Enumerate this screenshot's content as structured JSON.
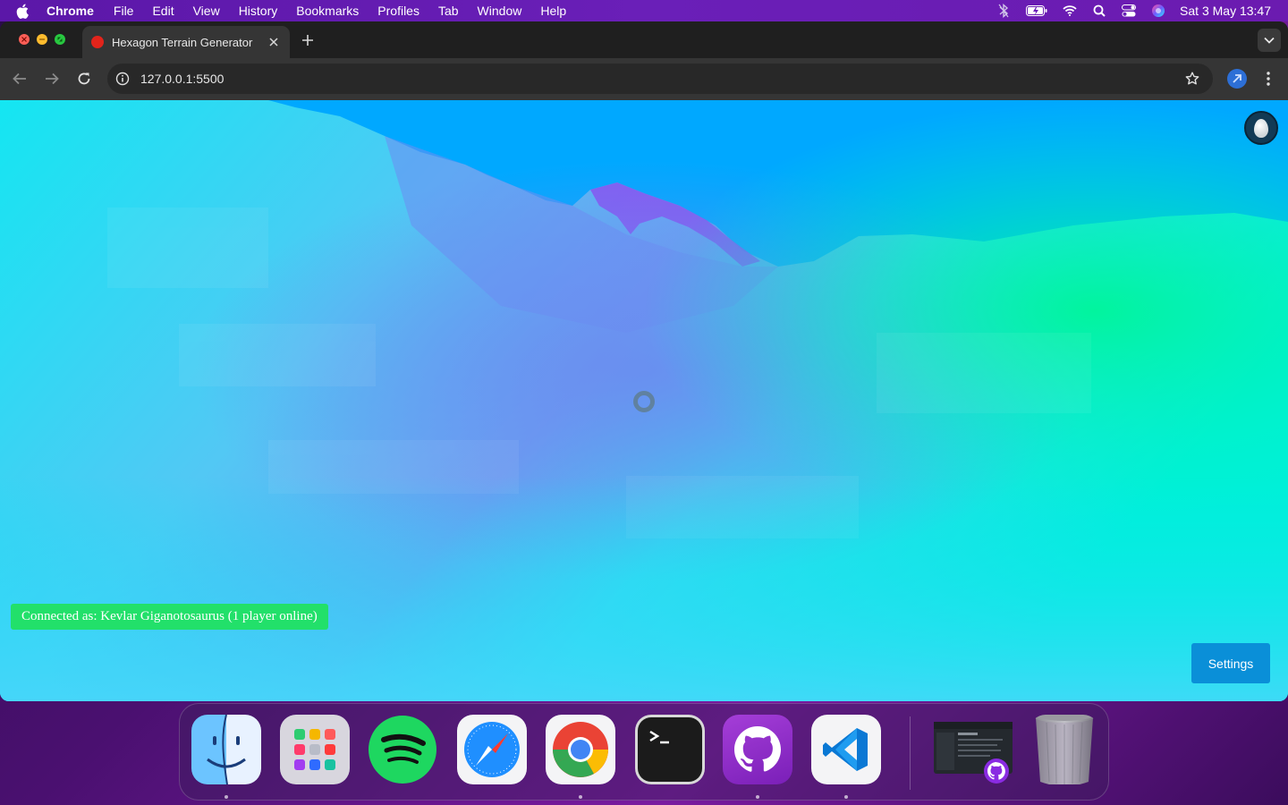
{
  "menubar": {
    "apple_icon": "apple-logo-icon",
    "app_name": "Chrome",
    "items": [
      "File",
      "Edit",
      "View",
      "History",
      "Bookmarks",
      "Profiles",
      "Tab",
      "Window",
      "Help"
    ],
    "status_icons": [
      "bluetooth-icon",
      "battery-icon",
      "wifi-icon",
      "spotlight-search-icon",
      "control-center-icon",
      "siri-icon"
    ],
    "clock": "Sat 3 May  13:47"
  },
  "browser": {
    "tab_title": "Hexagon Terrain Generator",
    "url": "127.0.0.1:5500",
    "theme": {
      "tabstrip": "#1f1f1f",
      "toolbar": "#353535",
      "omnibox": "#282828"
    }
  },
  "page": {
    "status_text": "Connected as: Kevlar Giganotosaurus (1 player online)",
    "status_color": "#22e06a",
    "settings_label": "Settings",
    "settings_color": "#0a8fd8",
    "sky_color": "#00a8ff",
    "terrain_colors": [
      "#00e8f2",
      "#5b8bf0",
      "#8a4ef0",
      "#00f5a0"
    ]
  },
  "dock": {
    "apps": [
      {
        "name": "Finder",
        "icon": "finder-icon",
        "running": true
      },
      {
        "name": "Launchpad",
        "icon": "launchpad-icon",
        "running": false
      },
      {
        "name": "Spotify",
        "icon": "spotify-icon",
        "running": false
      },
      {
        "name": "Safari",
        "icon": "safari-icon",
        "running": false
      },
      {
        "name": "Google Chrome",
        "icon": "chrome-icon",
        "running": true
      },
      {
        "name": "Terminal",
        "icon": "terminal-icon",
        "running": false
      },
      {
        "name": "GitHub Desktop",
        "icon": "github-desktop-icon",
        "running": true
      },
      {
        "name": "Visual Studio Code",
        "icon": "vscode-icon",
        "running": true
      },
      {
        "name": "GitHub Desktop window",
        "icon": "minimized-window-thumbnail",
        "running": false
      },
      {
        "name": "Trash",
        "icon": "trash-icon",
        "running": false
      }
    ]
  }
}
